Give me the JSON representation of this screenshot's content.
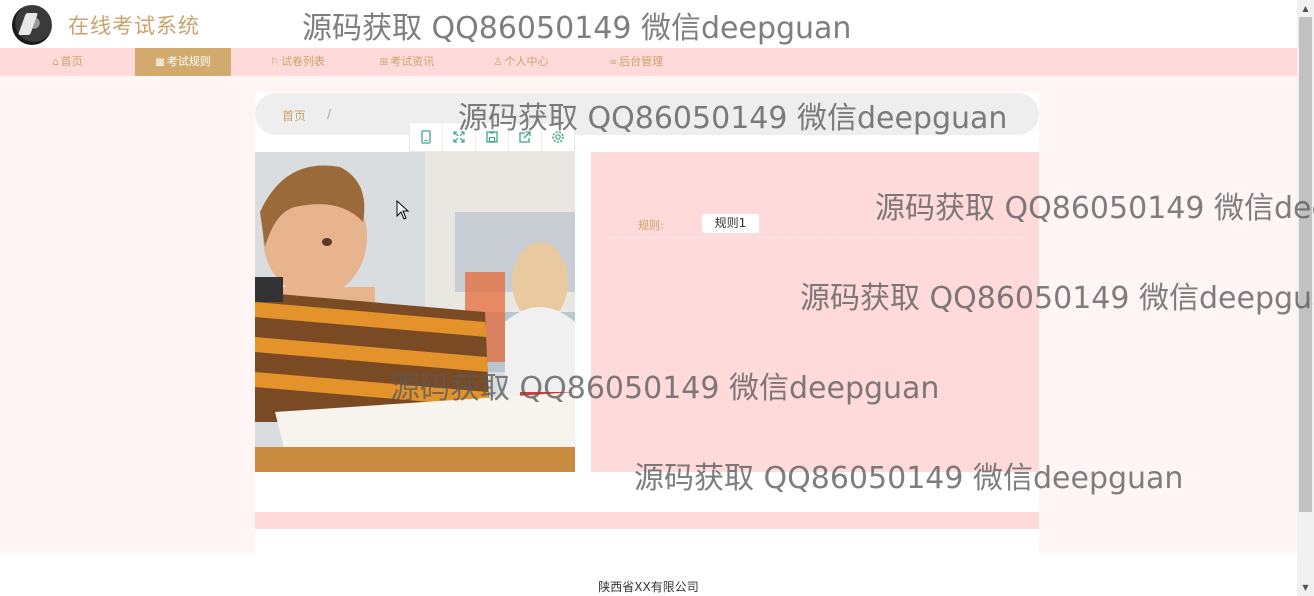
{
  "header": {
    "site_title": "在线考试系统"
  },
  "nav": [
    {
      "label": "首页",
      "icon": "home-icon",
      "active": false
    },
    {
      "label": "考试规则",
      "icon": "calendar-icon",
      "active": true
    },
    {
      "label": "试卷列表",
      "icon": "flag-icon",
      "active": false
    },
    {
      "label": "考试资讯",
      "icon": "grid-icon",
      "active": false
    },
    {
      "label": "个人中心",
      "icon": "user-icon",
      "active": false
    },
    {
      "label": "后台管理",
      "icon": "link-icon",
      "active": false
    }
  ],
  "breadcrumb": {
    "home": "首页",
    "separator": "/"
  },
  "toolbar": {
    "icons": [
      "tablet-icon",
      "fullscreen-icon",
      "save-icon",
      "share-icon",
      "settings-icon"
    ]
  },
  "rule": {
    "label": "规则:",
    "value": "规则1"
  },
  "footer": {
    "text": "陕西省XX有限公司"
  },
  "watermark": {
    "text": "源码获取 QQ86050149 微信deepguan"
  },
  "colors": {
    "accent": "#c9a36b",
    "active_nav": "#d2aa6e",
    "pink": "#ffdada",
    "page_bg": "#fff5f4"
  }
}
